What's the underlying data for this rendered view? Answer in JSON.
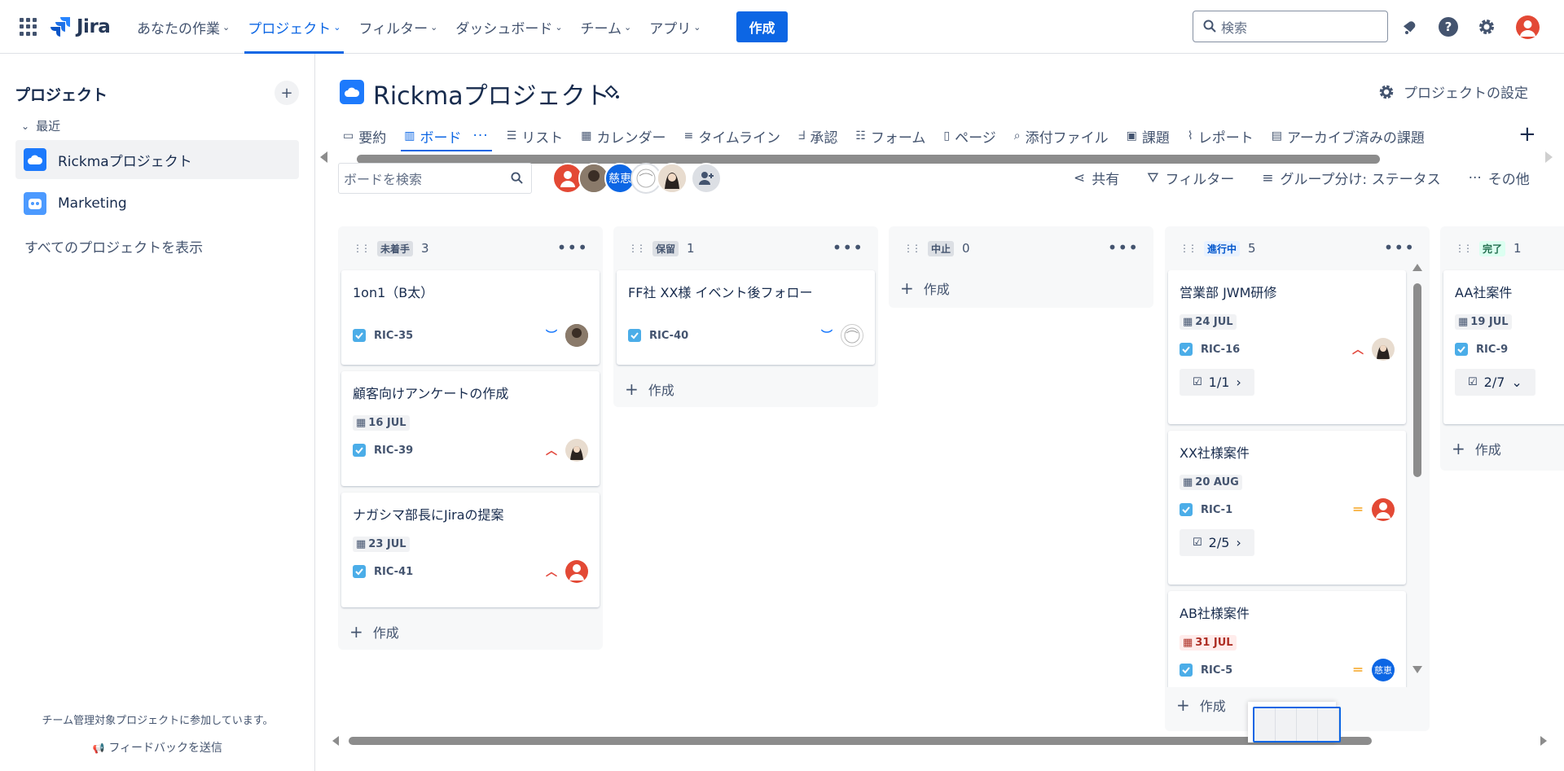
{
  "topnav": {
    "logo_text": "Jira",
    "items": [
      {
        "label": "あなたの作業"
      },
      {
        "label": "プロジェクト"
      },
      {
        "label": "フィルター"
      },
      {
        "label": "ダッシュボード"
      },
      {
        "label": "チーム"
      },
      {
        "label": "アプリ"
      }
    ],
    "create_label": "作成",
    "search_placeholder": "検索"
  },
  "sidebar": {
    "title": "プロジェクト",
    "recent_label": "最近",
    "projects": [
      {
        "name": "Rickmaプロジェクト"
      },
      {
        "name": "Marketing"
      }
    ],
    "view_all": "すべてのプロジェクトを表示",
    "footer_note": "チーム管理対象プロジェクトに参加しています。",
    "feedback": "フィードバックを送信"
  },
  "project": {
    "title": "Rickmaプロジェクト",
    "settings_label": "プロジェクトの設定"
  },
  "tabs": [
    {
      "label": "要約"
    },
    {
      "label": "ボード"
    },
    {
      "label": "リスト"
    },
    {
      "label": "カレンダー"
    },
    {
      "label": "タイムライン"
    },
    {
      "label": "承認"
    },
    {
      "label": "フォーム"
    },
    {
      "label": "ページ"
    },
    {
      "label": "添付ファイル"
    },
    {
      "label": "課題"
    },
    {
      "label": "レポート"
    },
    {
      "label": "アーカイブ済みの課題"
    }
  ],
  "board": {
    "search_placeholder": "ボードを検索",
    "avatar_text": "慈恵",
    "toolbar": {
      "share": "共有",
      "filter": "フィルター",
      "group": "グループ分け: ステータス",
      "more": "その他"
    },
    "create_label": "作成",
    "columns": [
      {
        "status": "未着手",
        "count": "3",
        "cards": [
          {
            "title": "1on1（B太）",
            "key": "RIC-35",
            "date": ""
          },
          {
            "title": "顧客向けアンケートの作成",
            "key": "RIC-39",
            "date": "16 JUL"
          },
          {
            "title": "ナガシマ部長にJiraの提案",
            "key": "RIC-41",
            "date": "23 JUL"
          }
        ]
      },
      {
        "status": "保留",
        "count": "1",
        "cards": [
          {
            "title": "FF社 XX様 イベント後フォロー",
            "key": "RIC-40",
            "date": ""
          }
        ]
      },
      {
        "status": "中止",
        "count": "0",
        "cards": []
      },
      {
        "status": "進行中",
        "count": "5",
        "cards": [
          {
            "title": "営業部 JWM研修",
            "key": "RIC-16",
            "date": "24 JUL",
            "subtasks": "1/1"
          },
          {
            "title": "XX社様案件",
            "key": "RIC-1",
            "date": "20 AUG",
            "subtasks": "2/5"
          },
          {
            "title": "AB社様案件",
            "key": "RIC-5",
            "date": "31 JUL"
          }
        ]
      },
      {
        "status": "完了",
        "count": "1",
        "cards": [
          {
            "title": "AA社案件",
            "key": "RIC-9",
            "date": "19 JUL",
            "subtasks": "2/7"
          }
        ]
      }
    ]
  },
  "colors": {
    "accent": "#0c66e4",
    "avatar_red": "#e34935",
    "prio_high": "#e2483d",
    "prio_low": "#1d7afc",
    "prio_medium": "#f5a623"
  }
}
